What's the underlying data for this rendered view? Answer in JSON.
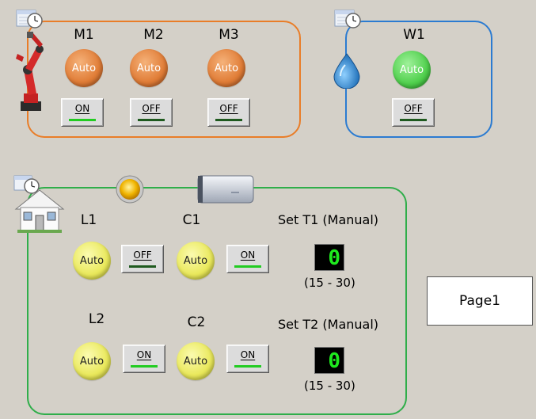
{
  "colors": {
    "motor_border": "#e97d28",
    "water_border": "#2b7bd1",
    "house_border": "#2fae4a"
  },
  "motors": {
    "m1": {
      "title": "M1",
      "mode": "Auto",
      "switch": "ON"
    },
    "m2": {
      "title": "M2",
      "mode": "Auto",
      "switch": "OFF"
    },
    "m3": {
      "title": "M3",
      "mode": "Auto",
      "switch": "OFF"
    }
  },
  "water": {
    "w1": {
      "title": "W1",
      "mode": "Auto",
      "switch": "OFF"
    }
  },
  "house": {
    "l1": {
      "title": "L1",
      "mode": "Auto",
      "switch": "OFF"
    },
    "c1": {
      "title": "C1",
      "mode": "Auto",
      "switch": "ON"
    },
    "l2": {
      "title": "L2",
      "mode": "Auto",
      "switch": "ON"
    },
    "c2": {
      "title": "C2",
      "mode": "Auto",
      "switch": "ON"
    },
    "t1": {
      "label": "Set T1 (Manual)",
      "value": "0",
      "range": "(15 - 30)"
    },
    "t2": {
      "label": "Set T2 (Manual)",
      "value": "0",
      "range": "(15 - 30)"
    }
  },
  "page_button": "Page1",
  "icons": [
    "calendar-clock-icon",
    "robot-arm-icon",
    "water-drop-icon",
    "house-icon",
    "bulb-icon",
    "air-conditioner-icon"
  ]
}
